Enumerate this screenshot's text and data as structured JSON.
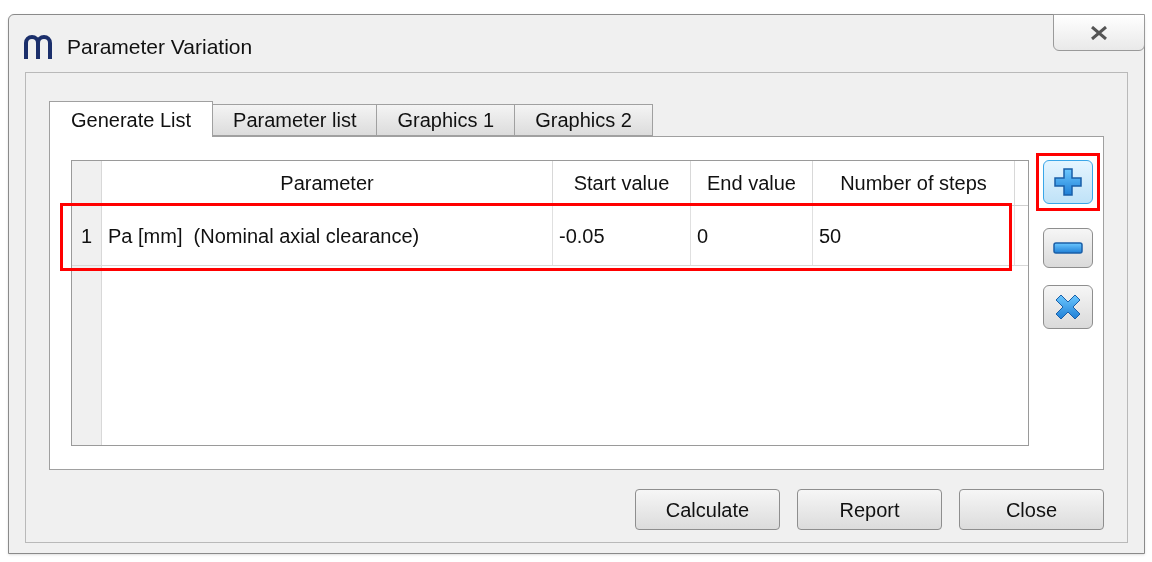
{
  "window": {
    "title": "Parameter Variation"
  },
  "tabs": [
    {
      "label": "Generate List",
      "selected": true
    },
    {
      "label": "Parameter list",
      "selected": false
    },
    {
      "label": "Graphics 1",
      "selected": false
    },
    {
      "label": "Graphics 2",
      "selected": false
    }
  ],
  "table": {
    "columns": [
      "Parameter",
      "Start value",
      "End value",
      "Number of steps"
    ],
    "rows": [
      {
        "index": "1",
        "cells": [
          "Pa [mm]  (Nominal axial clearance)",
          "-0.05",
          "0",
          "50"
        ],
        "highlighted": true
      }
    ]
  },
  "side_buttons": [
    {
      "kind": "add",
      "highlighted": true
    },
    {
      "kind": "remove",
      "highlighted": false
    },
    {
      "kind": "delete",
      "highlighted": false
    }
  ],
  "buttons": [
    "Calculate",
    "Report",
    "Close"
  ]
}
